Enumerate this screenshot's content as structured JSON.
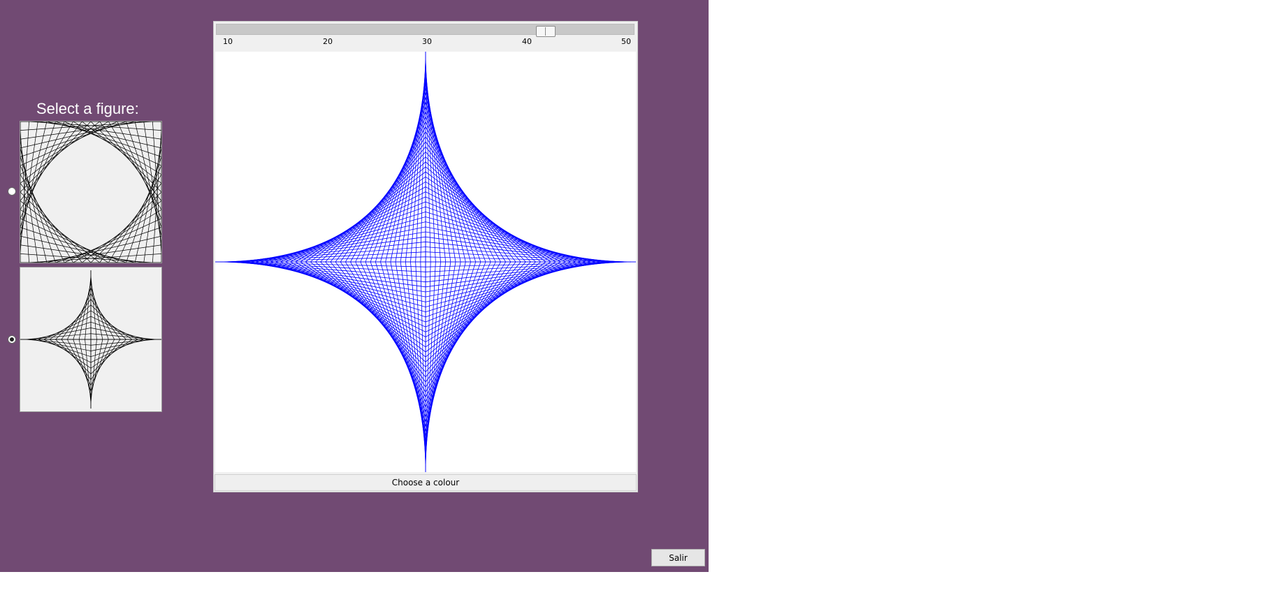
{
  "selector": {
    "title": "Select a figure:",
    "options": [
      {
        "icon": "parabolic-curve-stitching-icon",
        "checked": false
      },
      {
        "icon": "astroid-curve-stitching-icon",
        "checked": true
      }
    ]
  },
  "slider": {
    "min": 10,
    "max": 50,
    "value": 42,
    "tick_labels": [
      "10",
      "20",
      "30",
      "40",
      "50"
    ]
  },
  "canvas": {
    "figure": "astroid",
    "line_color": "#0000ff"
  },
  "colour_button": {
    "label": "Choose a colour"
  },
  "exit_button": {
    "label": "Salir"
  },
  "colors": {
    "window_background": "#714a73",
    "thumbnail_stroke": "#000000"
  }
}
